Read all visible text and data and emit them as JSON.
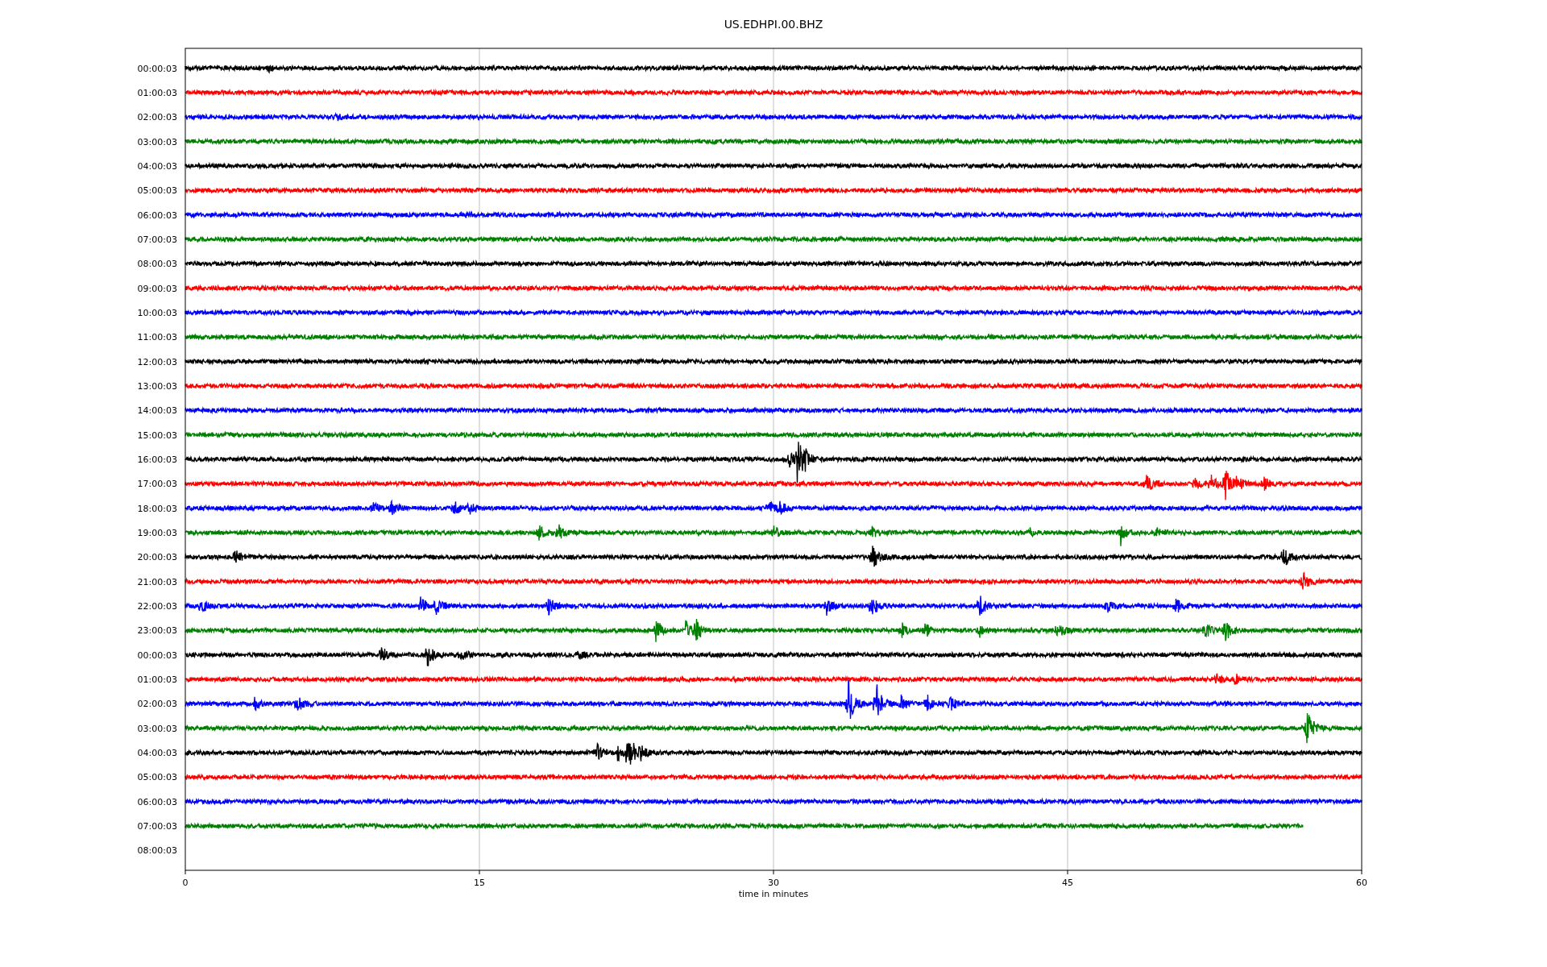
{
  "title": "US.EDHPI.00.BHZ",
  "xlabel": "time in minutes",
  "xticks": [
    "0",
    "15",
    "30",
    "45",
    "60"
  ],
  "rows": [
    {
      "label": "00:00:03",
      "color": "#000000",
      "level": 1
    },
    {
      "label": "01:00:03",
      "color": "#ff0000",
      "level": 1
    },
    {
      "label": "02:00:03",
      "color": "#0000ff",
      "level": 1
    },
    {
      "label": "03:00:03",
      "color": "#008000",
      "level": 1
    },
    {
      "label": "04:00:03",
      "color": "#000000",
      "level": 1
    },
    {
      "label": "05:00:03",
      "color": "#ff0000",
      "level": 1
    },
    {
      "label": "06:00:03",
      "color": "#0000ff",
      "level": 1
    },
    {
      "label": "07:00:03",
      "color": "#008000",
      "level": 1
    },
    {
      "label": "08:00:03",
      "color": "#000000",
      "level": 1
    },
    {
      "label": "09:00:03",
      "color": "#ff0000",
      "level": 1
    },
    {
      "label": "10:00:03",
      "color": "#0000ff",
      "level": 1
    },
    {
      "label": "11:00:03",
      "color": "#008000",
      "level": 1
    },
    {
      "label": "12:00:03",
      "color": "#000000",
      "level": 1
    },
    {
      "label": "13:00:03",
      "color": "#ff0000",
      "level": 1
    },
    {
      "label": "14:00:03",
      "color": "#0000ff",
      "level": 1
    },
    {
      "label": "15:00:03",
      "color": "#008000",
      "level": 1
    },
    {
      "label": "16:00:03",
      "color": "#000000",
      "level": 1
    },
    {
      "label": "17:00:03",
      "color": "#ff0000",
      "level": 1
    },
    {
      "label": "18:00:03",
      "color": "#0000ff",
      "level": 1
    },
    {
      "label": "19:00:03",
      "color": "#008000",
      "level": 1
    },
    {
      "label": "20:00:03",
      "color": "#000000",
      "level": 1
    },
    {
      "label": "21:00:03",
      "color": "#ff0000",
      "level": 1
    },
    {
      "label": "22:00:03",
      "color": "#0000ff",
      "level": 1
    },
    {
      "label": "23:00:03",
      "color": "#008000",
      "level": 1
    },
    {
      "label": "00:00:03",
      "color": "#000000",
      "level": 1
    },
    {
      "label": "01:00:03",
      "color": "#ff0000",
      "level": 1
    },
    {
      "label": "02:00:03",
      "color": "#0000ff",
      "level": 1
    },
    {
      "label": "03:00:03",
      "color": "#008000",
      "level": 1
    },
    {
      "label": "04:00:03",
      "color": "#000000",
      "level": 1
    },
    {
      "label": "05:00:03",
      "color": "#ff0000",
      "level": 1
    },
    {
      "label": "06:00:03",
      "color": "#0000ff",
      "level": 1
    },
    {
      "label": "07:00:03",
      "color": "#008000",
      "level": 0.95
    },
    {
      "label": "08:00:03"
    }
  ]
}
